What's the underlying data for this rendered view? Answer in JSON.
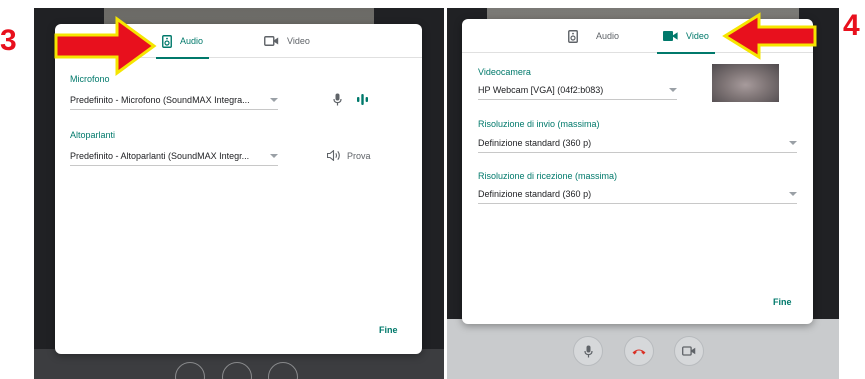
{
  "steps": {
    "left": "3",
    "right": "4"
  },
  "left_dialog": {
    "tabs": {
      "audio": "Audio",
      "video": "Video"
    },
    "microphone": {
      "label": "Microfono",
      "value": "Predefinito - Microfono (SoundMAX Integra..."
    },
    "speakers": {
      "label": "Altoparlanti",
      "value": "Predefinito - Altoparlanti (SoundMAX Integr...",
      "test_label": "Prova"
    },
    "done": "Fine"
  },
  "right_dialog": {
    "tabs": {
      "audio": "Audio",
      "video": "Video"
    },
    "camera": {
      "label": "Videocamera",
      "value": "HP Webcam [VGA] (04f2:b083)"
    },
    "send_resolution": {
      "label": "Risoluzione di invio (massima)",
      "value": "Definizione standard (360 p)"
    },
    "receive_resolution": {
      "label": "Risoluzione di ricezione (massima)",
      "value": "Definizione standard (360 p)"
    },
    "done": "Fine"
  },
  "colors": {
    "accent": "#00796b",
    "arrow": "#e8101d",
    "arrow_outline": "#f5e500",
    "hangup": "#d93025"
  },
  "icons": [
    "speaker-device-icon",
    "video-camera-icon",
    "microphone-icon",
    "audio-level-icon",
    "volume-icon",
    "hangup-icon"
  ]
}
